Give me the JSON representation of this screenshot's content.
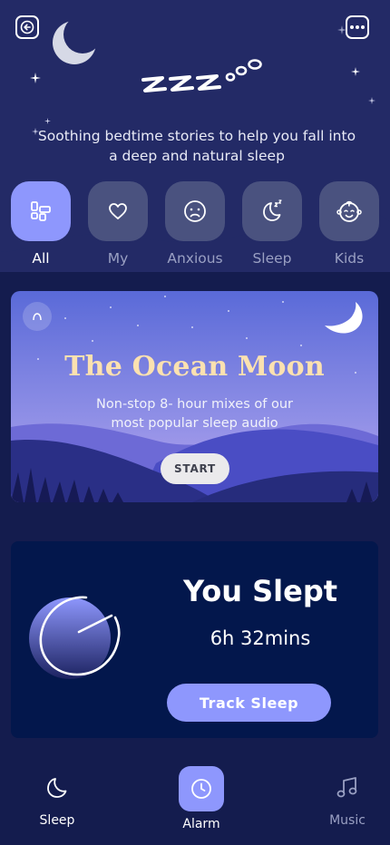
{
  "header": {
    "tagline": "Soothing bedtime stories to help you fall into a deep and natural sleep",
    "zzz_art": "zzz"
  },
  "categories": [
    {
      "label": "All",
      "icon": "grid-icon",
      "active": true
    },
    {
      "label": "My",
      "icon": "heart-icon",
      "active": false
    },
    {
      "label": "Anxious",
      "icon": "sad-face-icon",
      "active": false
    },
    {
      "label": "Sleep",
      "icon": "moon-zz-icon",
      "active": false
    },
    {
      "label": "Kids",
      "icon": "baby-face-icon",
      "active": false
    }
  ],
  "feature": {
    "title": "The Ocean Moon",
    "subtitle": "Non-stop 8- hour mixes of our most popular sleep audio",
    "start_label": "START"
  },
  "sleep_summary": {
    "title": "You Slept",
    "duration": "6h 32mins",
    "track_label": "Track Sleep"
  },
  "nav": [
    {
      "label": "Sleep",
      "icon": "moon-icon"
    },
    {
      "label": "Alarm",
      "icon": "clock-icon"
    },
    {
      "label": "Music",
      "icon": "music-note-icon"
    }
  ],
  "colors": {
    "accent": "#8e97fd",
    "background": "#141c4e",
    "header": "#232a66",
    "card": "#03174c",
    "title_gold": "#fbe1b0"
  }
}
